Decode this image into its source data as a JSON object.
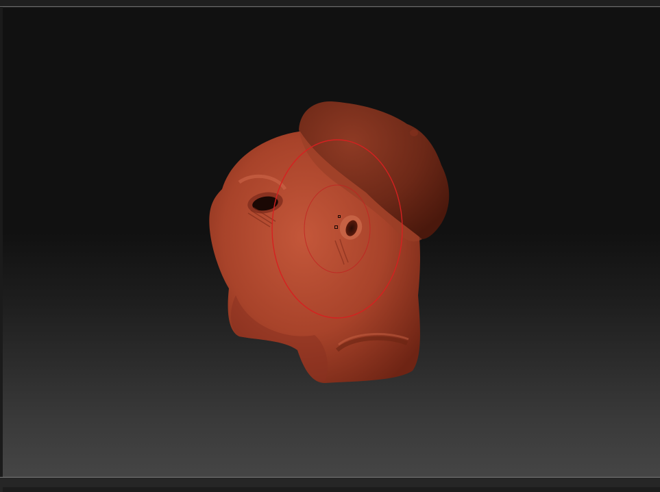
{
  "viewport": {
    "model_name": "",
    "colors": {
      "skin": "#b0452c",
      "skin_dark": "#6e2414",
      "hat": "#7a2e1c",
      "cursor": "#d62020",
      "background_top": "#111111",
      "background_bottom": "#454545"
    },
    "icons": {
      "brush_cursor": "draw-size-circle",
      "focal_point": "focal-point-marker"
    }
  }
}
